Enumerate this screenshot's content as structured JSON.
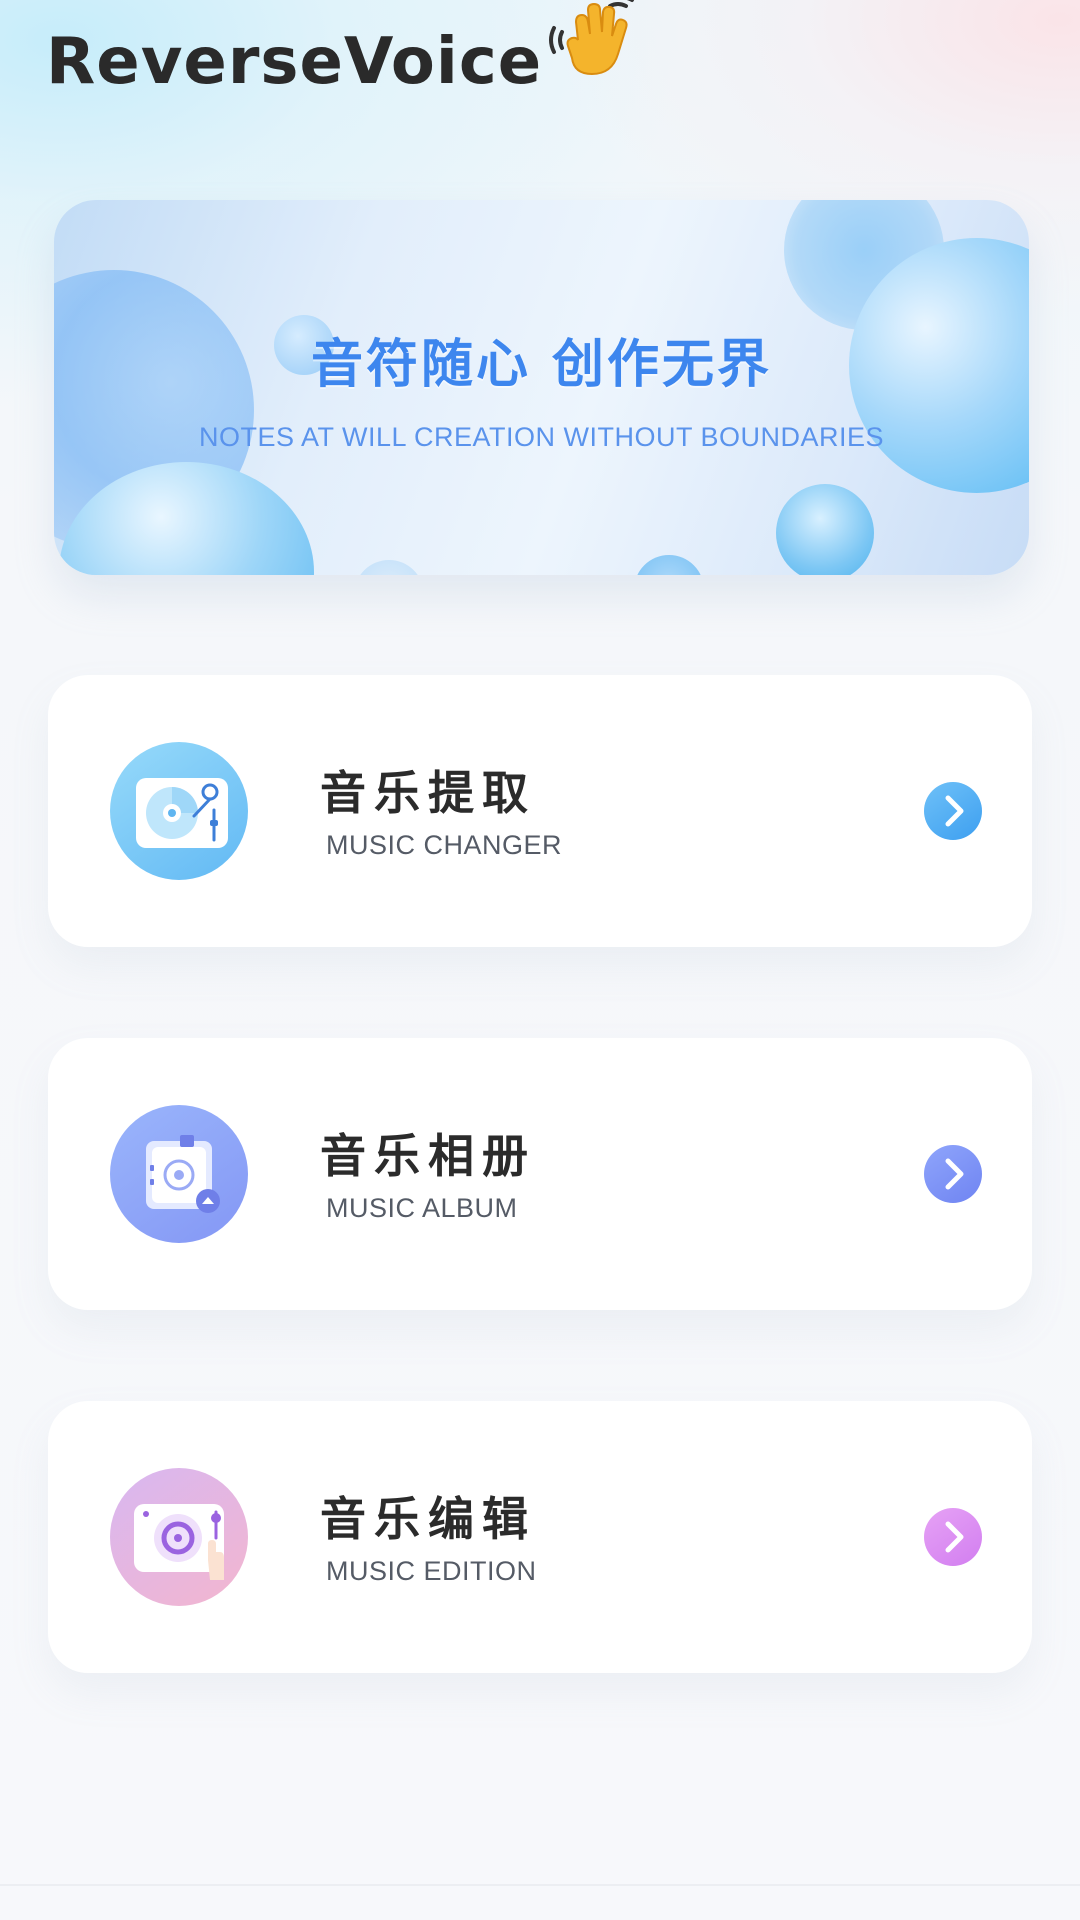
{
  "header": {
    "app_title": "ReverseVoice",
    "wave_icon": "waving-hand-emoji"
  },
  "banner": {
    "title": "音符随心 创作无界",
    "subtitle": "NOTES AT WILL CREATION WITHOUT BOUNDARIES"
  },
  "features": [
    {
      "title": "音乐提取",
      "subtitle": "MUSIC CHANGER",
      "icon": "turntable-icon",
      "accent": "#4aa9f2"
    },
    {
      "title": "音乐相册",
      "subtitle": "MUSIC ALBUM",
      "icon": "music-album-icon",
      "accent": "#7b8ff4"
    },
    {
      "title": "音乐编辑",
      "subtitle": "MUSIC EDITION",
      "icon": "music-edit-icon",
      "accent": "#d987f2"
    }
  ]
}
